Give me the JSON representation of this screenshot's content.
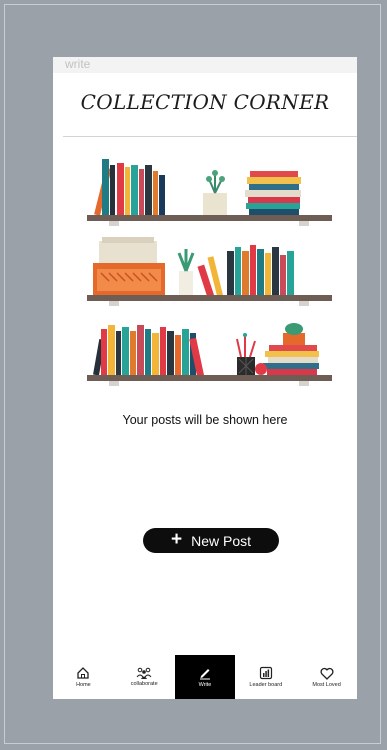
{
  "route_label": "write",
  "header": {
    "title": "COLLECTION CORNER"
  },
  "illustration": {
    "subject": "bookshelves-illustration"
  },
  "empty_state": {
    "message": "Your posts will be shown here"
  },
  "new_post_button": {
    "icon": "plus-icon",
    "label": "New Post"
  },
  "bottom_nav": {
    "items": [
      {
        "id": "home",
        "label": "Home",
        "icon": "home-icon",
        "active": false
      },
      {
        "id": "collaborate",
        "label": "collaborate",
        "icon": "people-icon",
        "active": false
      },
      {
        "id": "write",
        "label": "Write",
        "icon": "pencil-icon",
        "active": true
      },
      {
        "id": "leaderboard",
        "label": "Leader board",
        "icon": "chart-icon",
        "active": false
      },
      {
        "id": "most-loved",
        "label": "Most Loved",
        "icon": "heart-icon",
        "active": false
      }
    ]
  }
}
